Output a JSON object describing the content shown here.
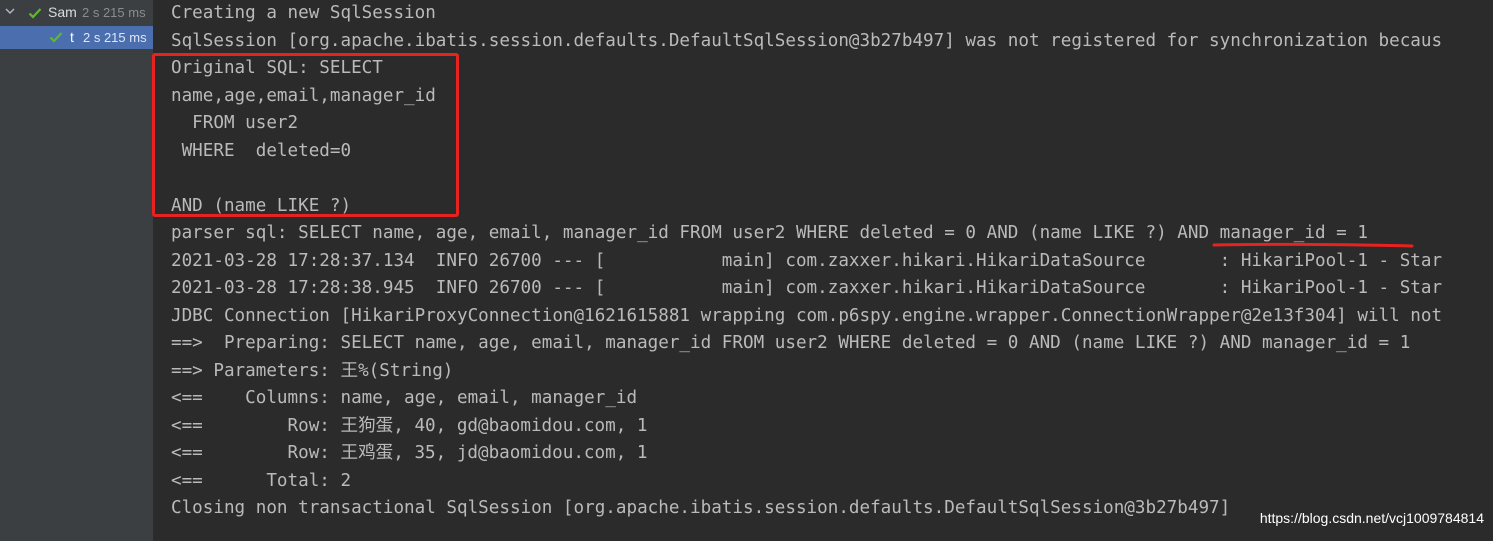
{
  "test_tree": {
    "rows": [
      {
        "name": "Sam",
        "time": "2 s 215 ms",
        "status": "passed"
      },
      {
        "name": "t",
        "time": "2 s 215 ms",
        "status": "passed",
        "selected": true
      }
    ]
  },
  "console": {
    "lines": [
      "Creating a new SqlSession",
      "SqlSession [org.apache.ibatis.session.defaults.DefaultSqlSession@3b27b497] was not registered for synchronization becaus",
      "Original SQL: SELECT",
      "name,age,email,manager_id",
      "  FROM user2",
      " WHERE  deleted=0",
      "",
      "AND (name LIKE ?)",
      "parser sql: SELECT name, age, email, manager_id FROM user2 WHERE deleted = 0 AND (name LIKE ?) AND manager_id = 1",
      "2021-03-28 17:28:37.134  INFO 26700 --- [           main] com.zaxxer.hikari.HikariDataSource       : HikariPool-1 - Star",
      "2021-03-28 17:28:38.945  INFO 26700 --- [           main] com.zaxxer.hikari.HikariDataSource       : HikariPool-1 - Star",
      "JDBC Connection [HikariProxyConnection@1621615881 wrapping com.p6spy.engine.wrapper.ConnectionWrapper@2e13f304] will not",
      "==>  Preparing: SELECT name, age, email, manager_id FROM user2 WHERE deleted = 0 AND (name LIKE ?) AND manager_id = 1",
      "==> Parameters: 王%(String)",
      "<==    Columns: name, age, email, manager_id",
      "<==        Row: 王狗蛋, 40, gd@baomidou.com, 1",
      "<==        Row: 王鸡蛋, 35, jd@baomidou.com, 1",
      "<==      Total: 2",
      "Closing non transactional SqlSession [org.apache.ibatis.session.defaults.DefaultSqlSession@3b27b497]"
    ]
  },
  "annotations": {
    "box_color": "#e8221f",
    "underline_color": "#e8221f"
  },
  "watermark": "https://blog.csdn.net/vcj1009784814",
  "colors": {
    "background": "#2b2b2b",
    "sidebar": "#3c3f41",
    "selection": "#4b6eaf",
    "text": "#bababa",
    "pass": "#5fb832"
  }
}
